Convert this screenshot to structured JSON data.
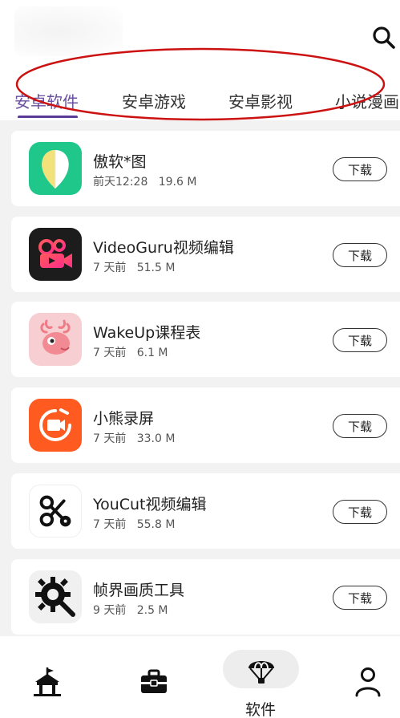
{
  "header": {
    "search_icon": "search-icon"
  },
  "tabs": [
    {
      "label": "安卓软件",
      "active": true
    },
    {
      "label": "安卓游戏",
      "active": false
    },
    {
      "label": "安卓影视",
      "active": false
    },
    {
      "label": "小说漫画",
      "active": false
    }
  ],
  "apps": [
    {
      "name": "傲软*图",
      "time": "前天12:28",
      "size": "19.6 M",
      "button": "下载",
      "icon": "leaf-icon"
    },
    {
      "name": "VideoGuru视频编辑",
      "time": "7 天前",
      "size": "51.5 M",
      "button": "下载",
      "icon": "video-camera-icon"
    },
    {
      "name": "WakeUp课程表",
      "time": "7 天前",
      "size": "6.1 M",
      "button": "下载",
      "icon": "deer-icon"
    },
    {
      "name": "小熊录屏",
      "time": "7 天前",
      "size": "33.0 M",
      "button": "下载",
      "icon": "screen-record-icon"
    },
    {
      "name": "YouCut视频编辑",
      "time": "7 天前",
      "size": "55.8 M",
      "button": "下载",
      "icon": "scissors-icon"
    },
    {
      "name": "帧界画质工具",
      "time": "9 天前",
      "size": "2.5 M",
      "button": "下载",
      "icon": "gear-icon"
    }
  ],
  "bottom_nav": {
    "items": [
      {
        "icon": "park-icon"
      },
      {
        "icon": "toolbox-icon"
      },
      {
        "icon": "parachute-icon",
        "label": "软件",
        "active": true
      },
      {
        "icon": "profile-icon"
      }
    ]
  },
  "colors": {
    "accent": "#5b3b97",
    "annotation": "#cc1111"
  }
}
